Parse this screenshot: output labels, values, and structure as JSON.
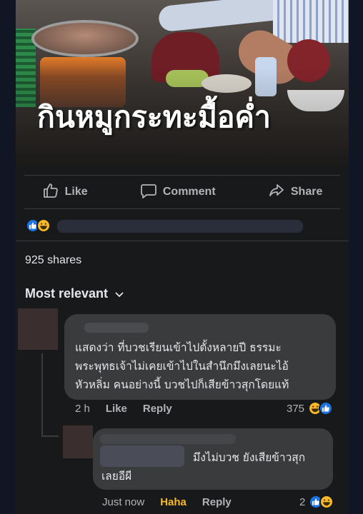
{
  "post": {
    "image_headline": "กินหมูกระทะมื้อค่ำ"
  },
  "actions": {
    "like": "Like",
    "comment": "Comment",
    "share": "Share"
  },
  "reactions_summary": {
    "icons": [
      "like-icon",
      "haha-icon"
    ]
  },
  "shares": "925 shares",
  "filter_label": "Most relevant",
  "comments": [
    {
      "text": "แสดงว่า ที่บวชเรียนเข้าไปตั้งหลายปี ธรรมะ\nพระพุทธเจ้าไม่เคยเข้าไปในสำนึกมึงเลยนะไอ้\nหัวหลิ่ม คนอย่างนี้ บวชไปก็เสียข้าวสุกโดยแท้",
      "time": "2 h",
      "like_label": "Like",
      "reply_label": "Reply",
      "reaction_count": "375"
    },
    {
      "text": "มึงไม่บวช ยังเสียข้าวสุก\nเลยอีผี",
      "time": "Just now",
      "like_label": "Haha",
      "reply_label": "Reply",
      "reaction_count": "2"
    }
  ],
  "colors": {
    "background": "#18191a",
    "bubble": "#3a3b3c",
    "muted_text": "#b0b3b8",
    "like_blue": "#1b74e4",
    "haha_yellow": "#f7b928"
  }
}
